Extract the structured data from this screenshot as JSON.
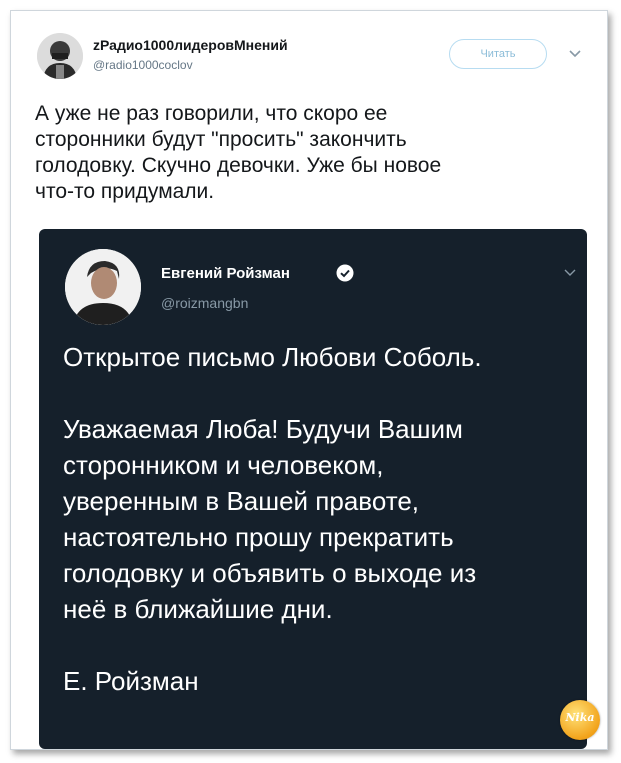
{
  "tweet": {
    "author_name": "zРадио1000лидеровМнений",
    "author_handle": "@radio1000coclov",
    "follow_label": "Читать",
    "text": "А уже не раз говорили, что скоро ее\nсторонники будут \"просить\" закончить\nголодовку. Скучно девочки. Уже бы новое\nчто-то придумали."
  },
  "quoted_tweet": {
    "author_name": "Евгений Ройзман",
    "author_handle": "@roizmangbn",
    "text": "Открытое письмо Любови Соболь.\n\nУважаемая Люба! Будучи Вашим\nсторонником и человеком,\nуверенным в Вашей правоте,\nнастоятельно прошу прекратить\nголодовку и объявить о выходе из\nнеё в ближайшие дни.\n\nЕ. Ройзман"
  },
  "watermark": {
    "text": "Nika"
  },
  "icons": {
    "caret": "chevron-down-icon",
    "verified": "verified-badge-icon"
  },
  "colors": {
    "quote_background": "#15202b",
    "verified_blue": "#1da1f2",
    "follow_border": "#b7dcf1",
    "handle_gray": "#657786"
  }
}
